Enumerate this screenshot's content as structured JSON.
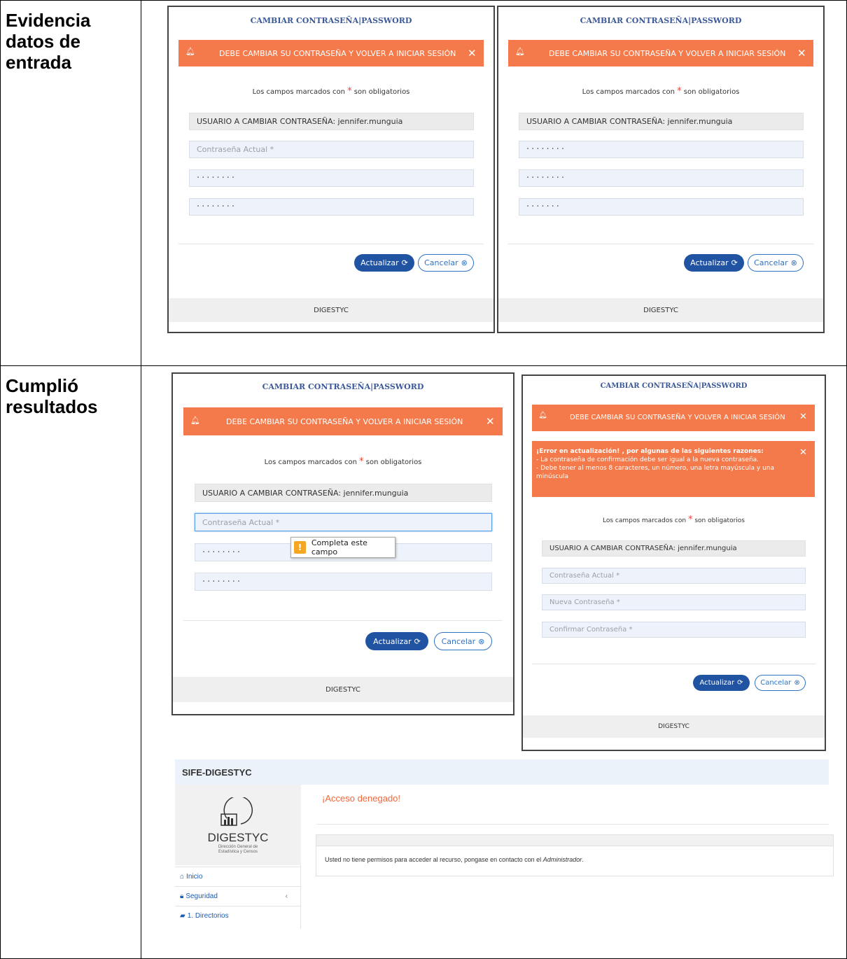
{
  "rows": [
    {
      "label": "Evidencia datos de entrada"
    },
    {
      "label": "Cumplió resultados"
    }
  ],
  "modal": {
    "title": "CAMBIAR CONTRASEÑA|PASSWORD",
    "alert": "DEBE CAMBIAR SU CONTRASEÑA Y VOLVER A INICIAR SESIÓN",
    "required_note_before": "Los campos marcados con",
    "required_star": "*",
    "required_note_after": "son obligatorios",
    "user_field": "USUARIO A CAMBIAR CONTRASEÑA: jennifer.munguia",
    "current_placeholder": "Contraseña Actual *",
    "new_placeholder": "Nueva Contraseña *",
    "confirm_placeholder": "Confirmar Contraseña *",
    "masked": "········",
    "masked_short": "·······",
    "update_label": "Actualizar",
    "cancel_label": "Cancelar",
    "footer": "DIGESTYC"
  },
  "tooltip": "Completa este campo",
  "error_alert": {
    "line1": "¡Error en actualización! , por algunas de las siguientes razones:",
    "line2": "- La contraseña de confirmación debe ser igual a la nueva contraseña.",
    "line3": "- Debe tener al menos 8 caracteres, un número, una letra mayúscula y una",
    "line4": "minúscula"
  },
  "sife": {
    "app_title": "SIFE-DIGESTYC",
    "logo_name": "DIGESTYC",
    "logo_sub1": "Dirección General de",
    "logo_sub2": "Estadística y Censos",
    "menu": [
      "Inicio",
      "Seguridad",
      "1. Directorios"
    ],
    "denied_title": "¡Acceso denegado!",
    "message_before": "Usted no tiene permisos para acceder al recurso, pongase en contacto con el",
    "message_em": "Administrador",
    "message_after": "."
  },
  "colors": {
    "alert": "#f47a4b",
    "primary": "#2153a3",
    "title": "#3b5998"
  }
}
